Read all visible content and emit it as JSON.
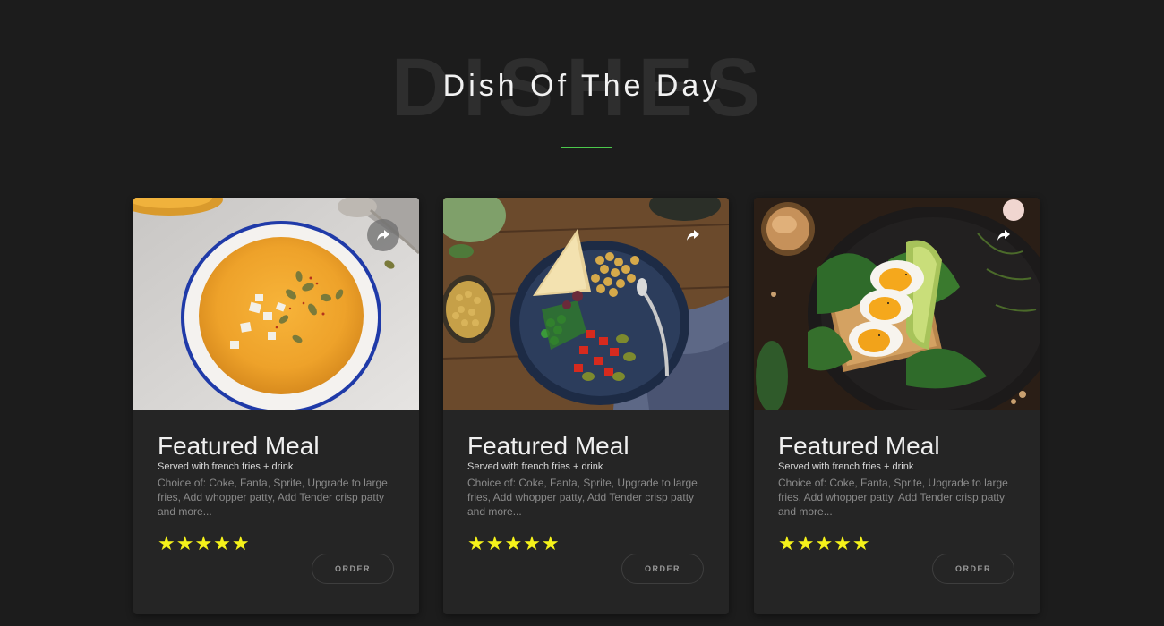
{
  "section": {
    "background_word": "DISHES",
    "title": "Dish Of The Day",
    "accent_color": "#4cc94c"
  },
  "cards": [
    {
      "image": "pumpkin-soup-bowl",
      "title": "Featured Meal",
      "subtitle": "Served with french fries + drink",
      "description": "Choice of: Coke, Fanta, Sprite, Upgrade to large fries, Add whopper patty, Add Tender crisp patty and more...",
      "rating": "★★★★★",
      "order_label": "ORDER",
      "share_icon": "share-icon"
    },
    {
      "image": "chickpea-salad-bowl",
      "title": "Featured Meal",
      "subtitle": "Served with french fries + drink",
      "description": "Choice of: Coke, Fanta, Sprite, Upgrade to large fries, Add whopper patty, Add Tender crisp patty and more...",
      "rating": "★★★★★",
      "order_label": "ORDER",
      "share_icon": "share-icon"
    },
    {
      "image": "egg-avocado-toast",
      "title": "Featured Meal",
      "subtitle": "Served with french fries + drink",
      "description": "Choice of: Coke, Fanta, Sprite, Upgrade to large fries, Add whopper patty, Add Tender crisp patty and more...",
      "rating": "★★★★★",
      "order_label": "ORDER",
      "share_icon": "share-icon"
    }
  ],
  "colors": {
    "page_bg": "#1c1c1c",
    "card_bg": "#252525",
    "star": "#f5f21a"
  }
}
